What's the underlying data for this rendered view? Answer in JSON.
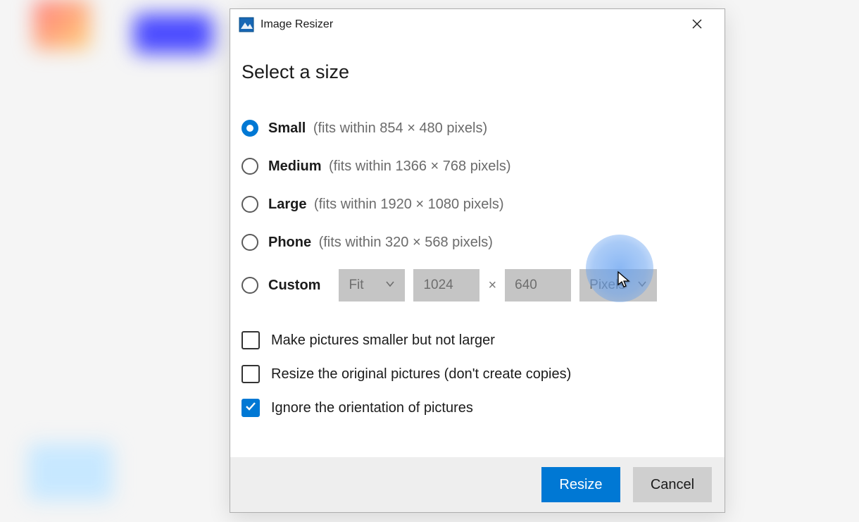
{
  "titlebar": {
    "app_name": "Image Resizer"
  },
  "dialog": {
    "heading": "Select a size"
  },
  "sizes": {
    "small": {
      "label": "Small",
      "desc": "(fits within 854 × 480 pixels)",
      "selected": true
    },
    "medium": {
      "label": "Medium",
      "desc": "(fits within 1366 × 768 pixels)",
      "selected": false
    },
    "large": {
      "label": "Large",
      "desc": "(fits within 1920 × 1080 pixels)",
      "selected": false
    },
    "phone": {
      "label": "Phone",
      "desc": "(fits within 320 × 568 pixels)",
      "selected": false
    },
    "custom": {
      "label": "Custom",
      "selected": false
    }
  },
  "custom": {
    "fit_mode": "Fit",
    "width": "1024",
    "times": "×",
    "height": "640",
    "unit": "Pixels"
  },
  "checks": {
    "smaller_only": {
      "label": "Make pictures smaller but not larger",
      "checked": false
    },
    "resize_original": {
      "label": "Resize the original pictures (don't create copies)",
      "checked": false
    },
    "ignore_orientation": {
      "label": "Ignore the orientation of pictures",
      "checked": true
    }
  },
  "footer": {
    "resize": "Resize",
    "cancel": "Cancel"
  },
  "colors": {
    "accent": "#0078d4"
  }
}
